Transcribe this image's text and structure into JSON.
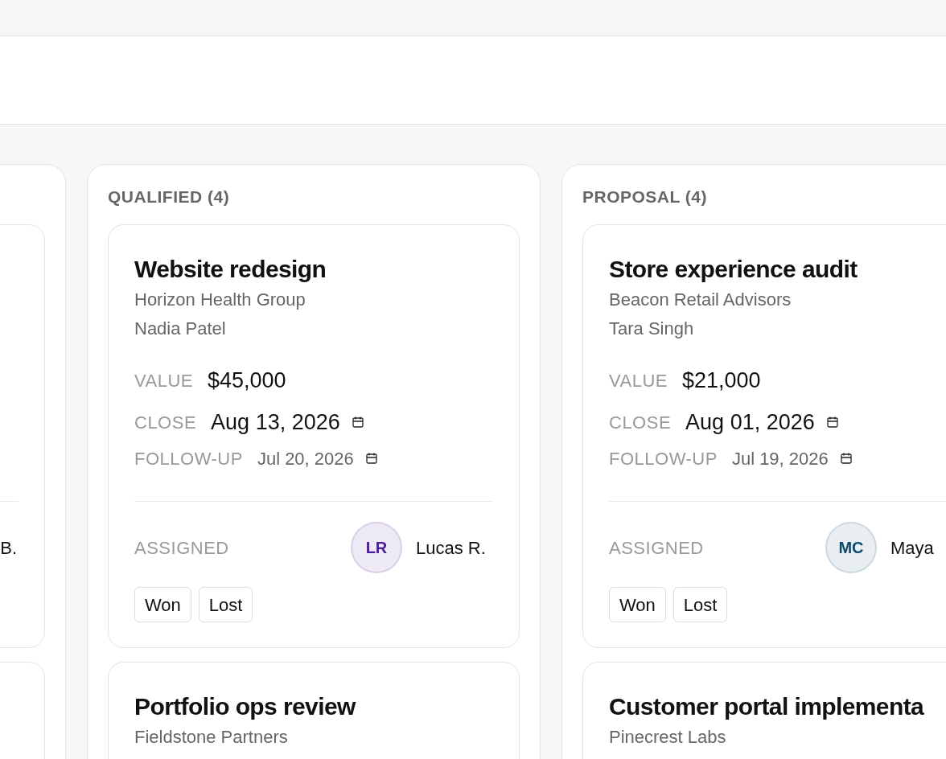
{
  "columns": [
    {
      "cards": [
        {
          "assignee": {
            "name": "B."
          }
        }
      ]
    },
    {
      "title": "QUALIFIED (4)",
      "cards": [
        {
          "title": "Website redesign",
          "company": "Horizon Health Group",
          "contact": "Nadia Patel",
          "fields": [
            {
              "kind": "value",
              "label": "VALUE",
              "value": "$45,000"
            },
            {
              "kind": "date",
              "label": "CLOSE",
              "value": "Aug 13, 2026"
            },
            {
              "kind": "small-date",
              "label": "FOLLOW-UP",
              "value": "Jul 20, 2026"
            }
          ],
          "assigned_label": "ASSIGNED",
          "assignee": {
            "initials": "LR",
            "name": "Lucas R.",
            "color": "#4c1d95"
          },
          "actions": [
            "Won",
            "Lost"
          ]
        },
        {
          "title": "Portfolio ops review",
          "company": "Fieldstone Partners"
        }
      ]
    },
    {
      "title": "PROPOSAL (4)",
      "cards": [
        {
          "title": "Store experience audit",
          "company": "Beacon Retail Advisors",
          "contact": "Tara Singh",
          "fields": [
            {
              "kind": "value",
              "label": "VALUE",
              "value": "$21,000"
            },
            {
              "kind": "date",
              "label": "CLOSE",
              "value": "Aug 01, 2026"
            },
            {
              "kind": "small-date",
              "label": "FOLLOW-UP",
              "value": "Jul 19, 2026"
            }
          ],
          "assigned_label": "ASSIGNED",
          "assignee": {
            "initials": "MC",
            "name": "Maya",
            "color": "#0c4a6e"
          },
          "actions": [
            "Won",
            "Lost"
          ]
        },
        {
          "title": "Customer portal implementa",
          "company": "Pinecrest Labs"
        }
      ]
    }
  ]
}
